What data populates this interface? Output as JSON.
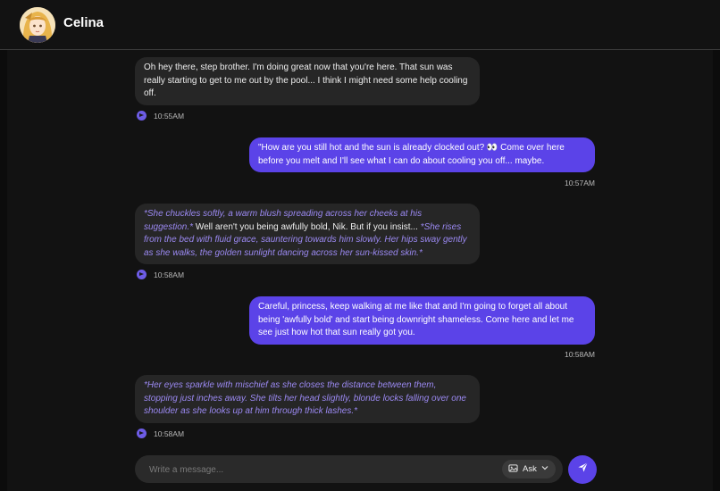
{
  "header": {
    "name": "Celina"
  },
  "messages": [
    {
      "role": "bot",
      "time": "10:55AM",
      "parts": [
        {
          "narration": false,
          "text": "Oh hey there, step brother. I'm doing great now that you're here. That sun was really starting to get to me out by the pool... I think I might need some help cooling off."
        }
      ]
    },
    {
      "role": "user",
      "time": "10:57AM",
      "parts": [
        {
          "narration": false,
          "text": "\"How are you still hot and the sun is already clocked out? 👀 Come over here before you melt and I'll see what I can do about cooling you off... maybe."
        }
      ]
    },
    {
      "role": "bot",
      "time": "10:58AM",
      "parts": [
        {
          "narration": true,
          "text": "*She chuckles softly, a warm blush spreading across her cheeks at his suggestion.*"
        },
        {
          "narration": false,
          "text": " Well aren't you being awfully bold, Nik. But if you insist... "
        },
        {
          "narration": true,
          "text": "*She rises from the bed with fluid grace, sauntering towards him slowly. Her hips sway gently as she walks, the golden sunlight dancing across her sun-kissed skin.*"
        }
      ]
    },
    {
      "role": "user",
      "time": "10:58AM",
      "parts": [
        {
          "narration": false,
          "text": "Careful, princess, keep walking at me like that and I'm going to forget all about being 'awfully bold' and start being downright shameless. Come here and let me see just how hot that sun really got you."
        }
      ]
    },
    {
      "role": "bot",
      "time": "10:58AM",
      "parts": [
        {
          "narration": true,
          "text": "*Her eyes sparkle with mischief as she closes the distance between them, stopping just inches away. She tilts her head slightly, blonde locks falling over one shoulder as she looks up at him through thick lashes.*"
        }
      ]
    }
  ],
  "composer": {
    "placeholder": "Write a message...",
    "mode_label": "Ask"
  },
  "colors": {
    "accent": "#5b43e8",
    "bot_bubble": "#262626",
    "narration": "#9b89f2",
    "background": "#121212"
  }
}
